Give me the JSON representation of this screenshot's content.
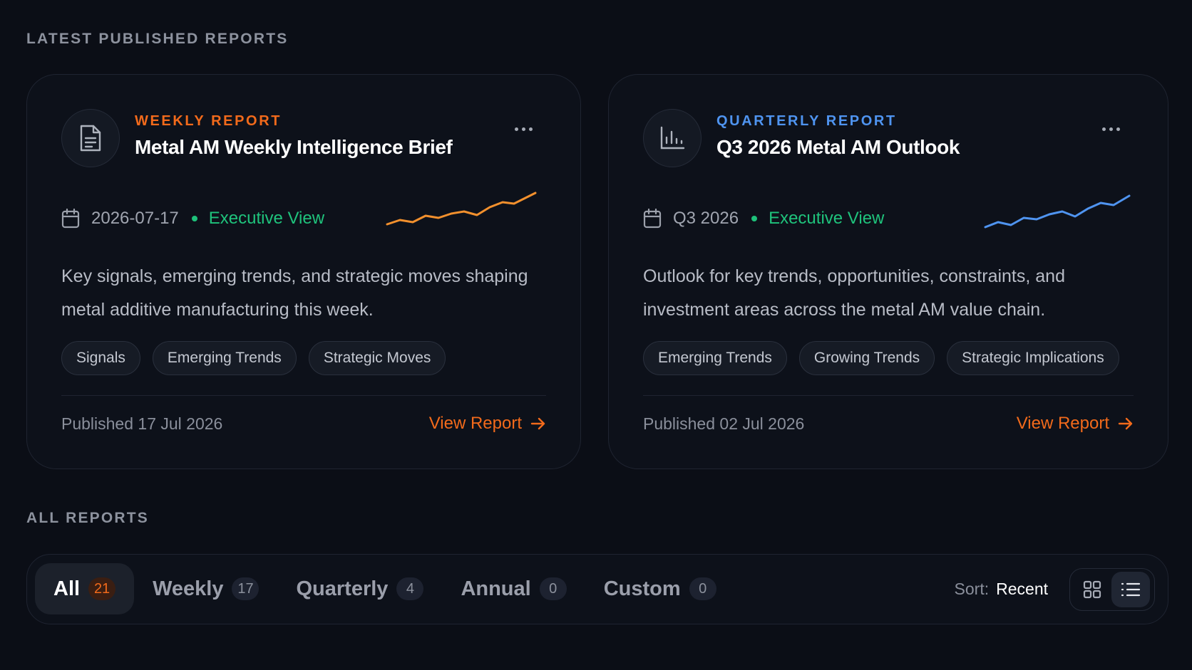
{
  "sections": {
    "latest_title": "LATEST PUBLISHED REPORTS",
    "all_title": "ALL REPORTS"
  },
  "cards": [
    {
      "kicker": "WEEKLY REPORT",
      "title": "Metal AM Weekly Intelligence Brief",
      "date": "2026-07-17",
      "view": "Executive View",
      "description": "Key signals, emerging trends, and strategic moves shaping metal additive manufacturing this week.",
      "tags": [
        "Signals",
        "Emerging Trends",
        "Strategic Moves"
      ],
      "published": "Published 17 Jul 2026",
      "cta": "View Report",
      "icon": "document-icon",
      "accent": "#f26a1b"
    },
    {
      "kicker": "QUARTERLY REPORT",
      "title": "Q3 2026 Metal AM Outlook",
      "date": "Q3 2026",
      "view": "Executive View",
      "description": "Outlook for key trends, opportunities, constraints, and investment areas across the metal AM value chain.",
      "tags": [
        "Emerging Trends",
        "Growing Trends",
        "Strategic Implications"
      ],
      "published": "Published 02 Jul 2026",
      "cta": "View Report",
      "icon": "bar-chart-icon",
      "accent": "#4f94f0"
    }
  ],
  "filters": [
    {
      "label": "All",
      "count": "21",
      "active": true
    },
    {
      "label": "Weekly",
      "count": "17",
      "active": false
    },
    {
      "label": "Quarterly",
      "count": "4",
      "active": false
    },
    {
      "label": "Annual",
      "count": "0",
      "active": false
    },
    {
      "label": "Custom",
      "count": "0",
      "active": false
    }
  ],
  "sort": {
    "label": "Sort:",
    "value": "Recent"
  },
  "view_toggle": {
    "grid_icon": "grid-icon",
    "list_icon": "list-icon",
    "active": "list"
  },
  "colors": {
    "orange": "#f26a1b",
    "blue": "#4f94f0",
    "green": "#1fc37c",
    "background": "#0b0e16"
  }
}
